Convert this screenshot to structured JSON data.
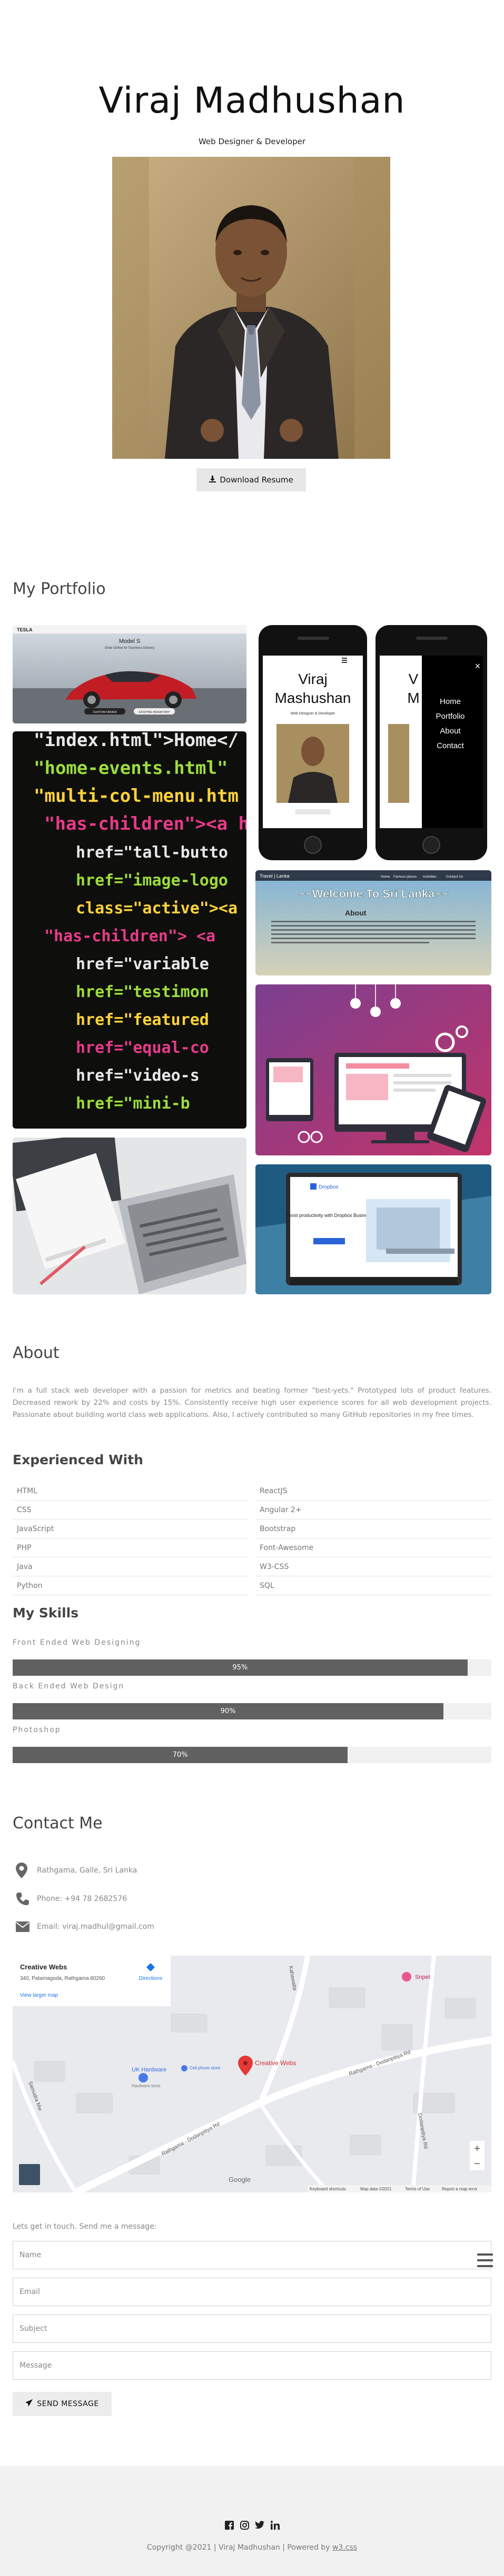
{
  "hero": {
    "name": "Viraj Madhushan",
    "subtitle": "Web Designer & Developer",
    "download_label": "Download Resume"
  },
  "portfolio": {
    "title": "My Portfolio",
    "tesla": {
      "brand": "TESLA",
      "model": "Model S",
      "tagline": "Order Online for Touchless Delivery",
      "btn_custom": "CUSTOM ORDER",
      "btn_existing": "EXISTING INVENTORY"
    },
    "phone_profile": {
      "first": "Viraj",
      "last": "Mashushan",
      "sub": "Web Designer & Developer"
    },
    "phone_menu": {
      "items": [
        "Home",
        "Portfolio",
        "About",
        "Contact"
      ],
      "close": "×"
    },
    "travel": {
      "brand": "Travel | Lanka",
      "nav": [
        "Home",
        "Famous places",
        "Activities",
        "Contact Us"
      ],
      "heading": "~~Welcome To Sri Lanka~~",
      "about": "About"
    },
    "code_lines": [
      "\"index.html\">Home</",
      "\"home-events.html\"",
      "\"multi-col-menu.htm",
      "\"has-children\"><a h",
      "href=\"tall-butto",
      "href=\"image-logo",
      "class=\"active\"><a h",
      "\"has-children\"> <a",
      "href=\"variable",
      "href=\"testimon",
      "href=\"featured",
      "href=\"equal-co",
      "href=\"video-s",
      "href=\"mini-b"
    ],
    "landing": {
      "logo": "Dropbox",
      "heading": "Boost productivity with Dropbox Business"
    }
  },
  "about": {
    "title": "About",
    "text": "I'm a full stack web developer with a passion for metrics and beating former \"best-yets.\" Prototyped lots of product features. Decreased rework by 22% and costs by 15%. Consistently receive high user experience scores for all web development projects. Passionate about building world class web applications. Also, I actively contributed so many GitHub repositories in my free times."
  },
  "experienced": {
    "title": "Experienced With",
    "left": [
      "HTML",
      "CSS",
      "JavaScript",
      "PHP",
      "Java",
      "Python"
    ],
    "right": [
      "ReactJS",
      "Angular 2+",
      "Bootstrap",
      "Font-Awesome",
      "W3-CSS",
      "SQL"
    ]
  },
  "skills": {
    "title": "My Skills",
    "items": [
      {
        "label": "Front Ended Web Designing",
        "percent": 95,
        "text": "95%"
      },
      {
        "label": "Back Ended Web Design",
        "percent": 90,
        "text": "90%"
      },
      {
        "label": "Photoshop",
        "percent": 70,
        "text": "70%"
      }
    ]
  },
  "contact": {
    "title": "Contact Me",
    "address": "Rathgama, Galle, Sri Lanka",
    "phone": "Phone: +94 78 2682576",
    "email": "Email: viraj.madhul@gmail.com"
  },
  "map": {
    "card_title": "Creative Webs",
    "card_address": "340, Patamagoda, Rathgama 80260",
    "card_link": "View larger map",
    "card_directions": "Directions",
    "pin_label": "Creative Webs",
    "place_snpet": "Snpet",
    "place_hardware": "UK Hardware",
    "place_hardware_sub": "Hardware store",
    "place_cell": "Cell phone store",
    "road_samudra": "Samudra Mw",
    "road_dodanpitiya": "Rathgama - Dodanpitiya Rd",
    "road_dodanpitiya2": "Rathgama - Dodanpitiya Rd",
    "road_kahawatta": "Kahawatta",
    "road_dodanpitiya3": "Dodanpitiya Rd",
    "zoom_in": "+",
    "zoom_out": "−",
    "brand": "Google",
    "footer": [
      "Keyboard shortcuts",
      "Map data ©2021",
      "Terms of Use",
      "Report a map error"
    ]
  },
  "form": {
    "note": "Lets get in touch. Send me a message:",
    "name_ph": "Name",
    "email_ph": "Email",
    "subject_ph": "Subject",
    "message_ph": "Message",
    "send_label": "SEND MESSAGE"
  },
  "footer": {
    "copy": "Copyright @2021 | Viraj Madhushan | Powered by ",
    "link": "w3.css"
  },
  "colors": {
    "skill_fill": "#616161",
    "skill_track": "#f1f1f1",
    "footer_bg": "#f1f1f1",
    "map_pin": "#e53935"
  }
}
